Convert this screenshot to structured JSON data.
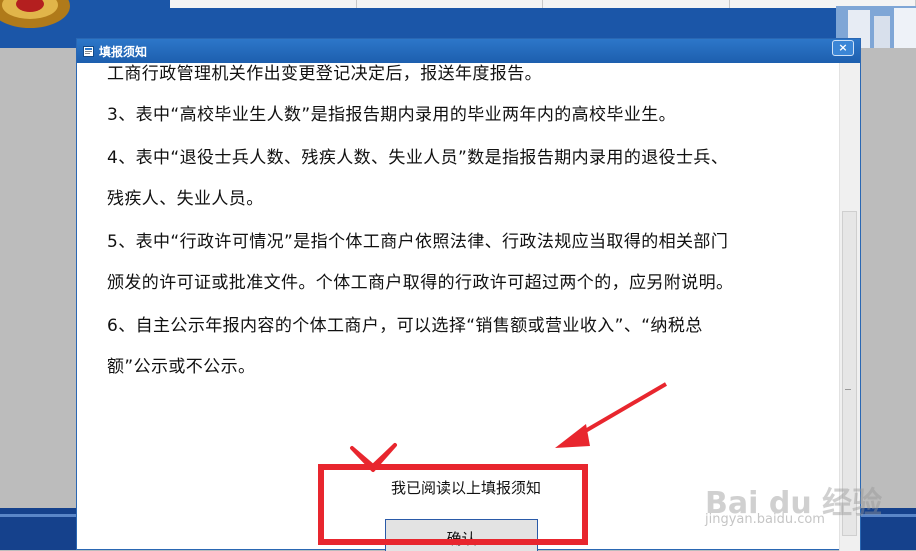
{
  "dialog": {
    "title": "填报须知",
    "close_label": "×",
    "paragraphs": [
      "工商行政管理机关作出变更登记决定后，报送年度报告。",
      "3、表中“高校毕业生人数”是指报告期内录用的毕业两年内的高校毕业生。",
      "4、表中“退役士兵人数、残疾人数、失业人员”数是指报告期内录用的退役士兵、",
      "残疾人、失业人员。",
      "5、表中“行政许可情况”是指个体工商户依照法律、行政法规应当取得的相关部门",
      "颁发的许可证或批准文件。个体工商户取得的行政许可超过两个的，应另附说明。",
      "6、自主公示年报内容的个体工商户，可以选择“销售额或营业收入”、“纳税总",
      "额”公示或不公示。"
    ],
    "ack_text": "我已阅读以上填报须知",
    "confirm_label": "确认"
  },
  "watermark": {
    "brand": "Bai du 经验",
    "url": "jingyan.baidu.com"
  },
  "colors": {
    "titlebar": "#1d5fae",
    "annotation_red": "#e8262e",
    "app_blue": "#1b56a8"
  },
  "icons": {
    "title": "window-icon",
    "close": "close-icon",
    "check": "checkmark-annotation",
    "arrow": "arrow-annotation"
  }
}
